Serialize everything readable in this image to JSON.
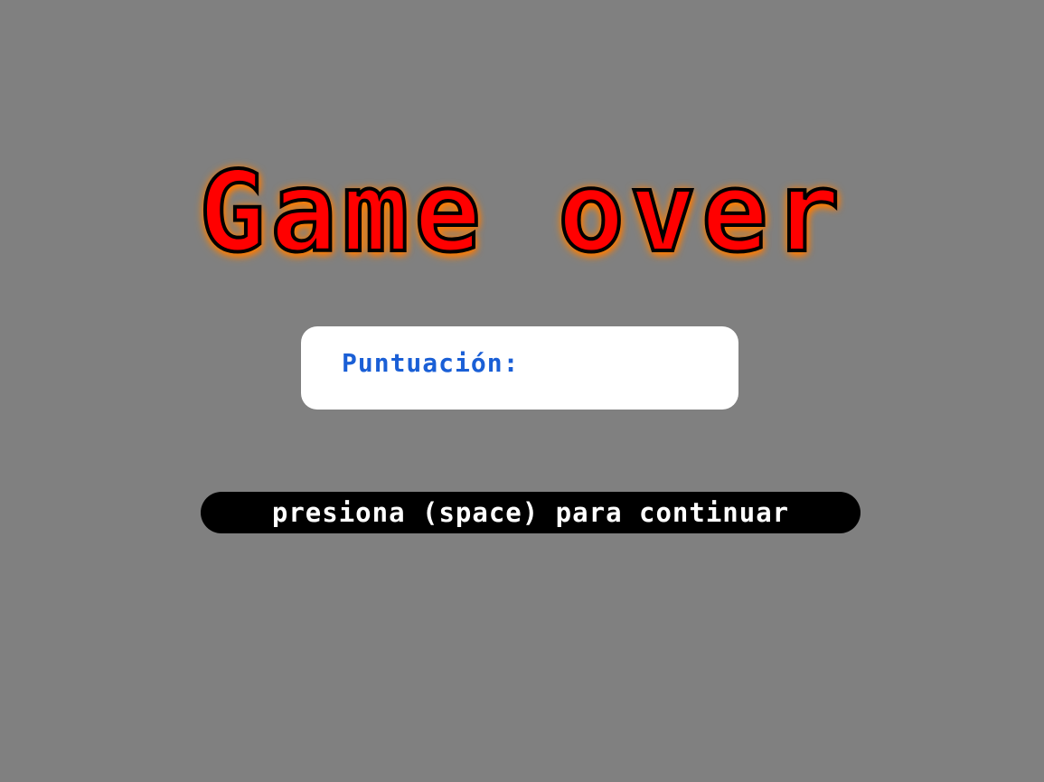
{
  "title": "Game over",
  "score": {
    "label": "Puntuación:",
    "value": ""
  },
  "prompt": {
    "text": "presiona (space) para continuar"
  },
  "colors": {
    "background": "#808080",
    "title_fill": "#ff0000",
    "title_outline": "#000000",
    "title_glow": "#ff8c00",
    "score_text": "#1a5fd6",
    "panel_bg": "#ffffff",
    "prompt_bg": "#000000",
    "prompt_text": "#ffffff"
  }
}
